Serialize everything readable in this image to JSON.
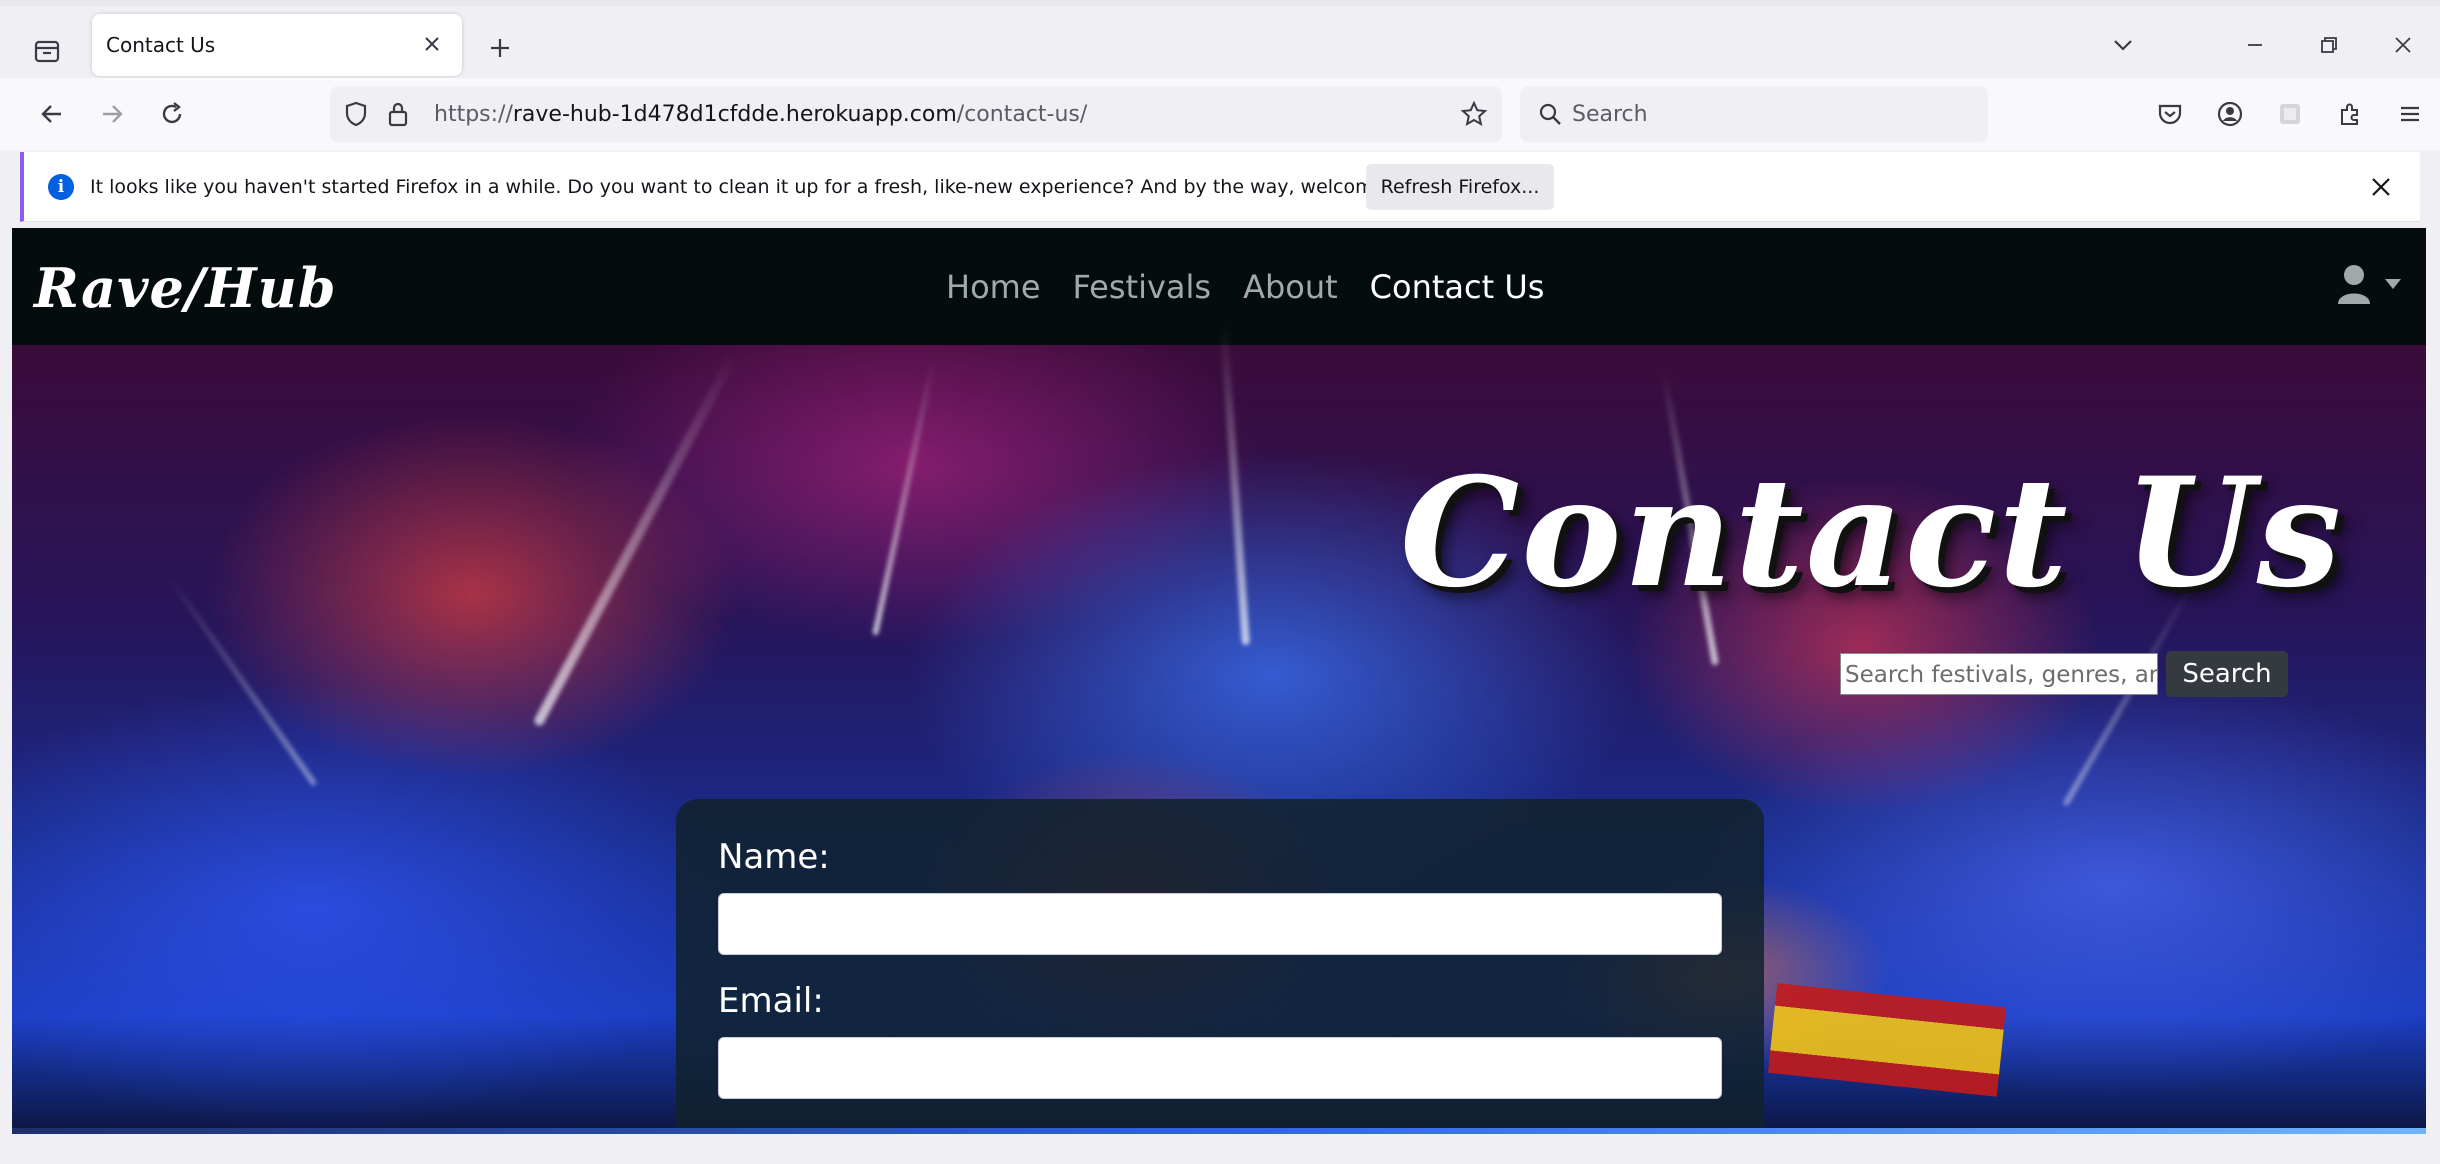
{
  "browser": {
    "tab_title": "Contact Us",
    "url_scheme": "https://",
    "url_host": "rave-hub-1d478d1cfdde.herokuapp.com",
    "url_path": "/contact-us/",
    "search_placeholder": "Search"
  },
  "notification": {
    "message": "It looks like you haven't started Firefox in a while. Do you want to clean it up for a fresh, like-new experience? And by the way, welcome back!",
    "button_label": "Refresh Firefox..."
  },
  "site": {
    "brand": "Rave/Hub",
    "nav": {
      "home": "Home",
      "festivals": "Festivals",
      "about": "About",
      "contact": "Contact Us"
    }
  },
  "hero": {
    "title": "Contact Us",
    "search_value": "Search festivals, genres, ar",
    "search_button": "Search"
  },
  "form": {
    "name_label": "Name:",
    "email_label": "Email:"
  },
  "colors": {
    "accent": "#0060df",
    "nav_bg": "#050c0d",
    "nav_link": "#a3a8ab",
    "nav_link_active": "#ffffff",
    "search_button_bg": "#343a40",
    "form_card_bg": "#10222c"
  }
}
